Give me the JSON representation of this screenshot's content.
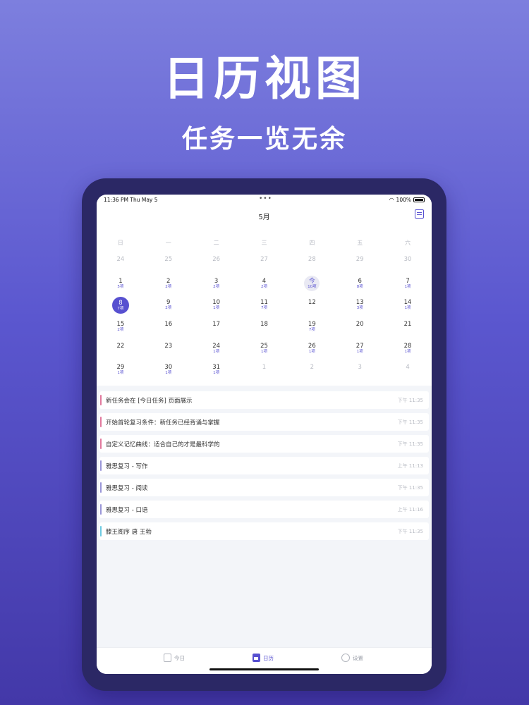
{
  "hero": {
    "title": "日历视图",
    "subtitle": "任务一览无余"
  },
  "status_bar": {
    "time": "11:36 PM   Thu May 5",
    "dots": "•••",
    "battery": "100%"
  },
  "calendar": {
    "month": "5月",
    "weekdays": [
      "日",
      "一",
      "二",
      "三",
      "四",
      "五",
      "六"
    ],
    "days": [
      {
        "n": "24",
        "c": "",
        "other": true
      },
      {
        "n": "25",
        "c": "",
        "other": true
      },
      {
        "n": "26",
        "c": "",
        "other": true
      },
      {
        "n": "27",
        "c": "",
        "other": true
      },
      {
        "n": "28",
        "c": "",
        "other": true
      },
      {
        "n": "29",
        "c": "",
        "other": true
      },
      {
        "n": "30",
        "c": "",
        "other": true
      },
      {
        "n": "1",
        "c": "5项"
      },
      {
        "n": "2",
        "c": "2项"
      },
      {
        "n": "3",
        "c": "2项"
      },
      {
        "n": "4",
        "c": "2项"
      },
      {
        "n": "今",
        "c": "10项",
        "today": true
      },
      {
        "n": "6",
        "c": "8项"
      },
      {
        "n": "7",
        "c": "1项"
      },
      {
        "n": "8",
        "c": "7项",
        "selected": true
      },
      {
        "n": "9",
        "c": "2项"
      },
      {
        "n": "10",
        "c": "1项"
      },
      {
        "n": "11",
        "c": "7项"
      },
      {
        "n": "12",
        "c": ""
      },
      {
        "n": "13",
        "c": "3项"
      },
      {
        "n": "14",
        "c": "1项"
      },
      {
        "n": "15",
        "c": "2项"
      },
      {
        "n": "16",
        "c": ""
      },
      {
        "n": "17",
        "c": ""
      },
      {
        "n": "18",
        "c": ""
      },
      {
        "n": "19",
        "c": "7项"
      },
      {
        "n": "20",
        "c": ""
      },
      {
        "n": "21",
        "c": ""
      },
      {
        "n": "22",
        "c": ""
      },
      {
        "n": "23",
        "c": ""
      },
      {
        "n": "24",
        "c": "1项"
      },
      {
        "n": "25",
        "c": "1项"
      },
      {
        "n": "26",
        "c": "1项"
      },
      {
        "n": "27",
        "c": "1项"
      },
      {
        "n": "28",
        "c": "1项"
      },
      {
        "n": "29",
        "c": "1项"
      },
      {
        "n": "30",
        "c": "1项"
      },
      {
        "n": "31",
        "c": "1项"
      },
      {
        "n": "1",
        "c": "",
        "other": true
      },
      {
        "n": "2",
        "c": "",
        "other": true
      },
      {
        "n": "3",
        "c": "",
        "other": true
      },
      {
        "n": "4",
        "c": "",
        "other": true
      }
    ]
  },
  "tasks": [
    {
      "title": "新任务会在 [今日任务] 页面展示",
      "time": "下午 11:35",
      "color": "#e2799d"
    },
    {
      "title": "开始首轮复习条件：新任务已经背诵与掌握",
      "time": "下午 11:35",
      "color": "#e2799d"
    },
    {
      "title": "自定义记忆曲线：适合自己的才是最科学的",
      "time": "下午 11:35",
      "color": "#e2799d"
    },
    {
      "title": "雅思复习 - 写作",
      "time": "上午 11:13",
      "color": "#9a96d8"
    },
    {
      "title": "雅思复习 - 阅读",
      "time": "下午 11:35",
      "color": "#9a96d8"
    },
    {
      "title": "雅思复习 - 口语",
      "time": "上午 11:16",
      "color": "#9a96d8"
    },
    {
      "title": "滕王阁序  唐  王勃",
      "time": "下午 11:35",
      "color": "#6ecbe2"
    }
  ],
  "tabs": {
    "today": "今日",
    "calendar": "日历",
    "settings": "设置"
  },
  "colors": {
    "accent": "#5750d0"
  }
}
